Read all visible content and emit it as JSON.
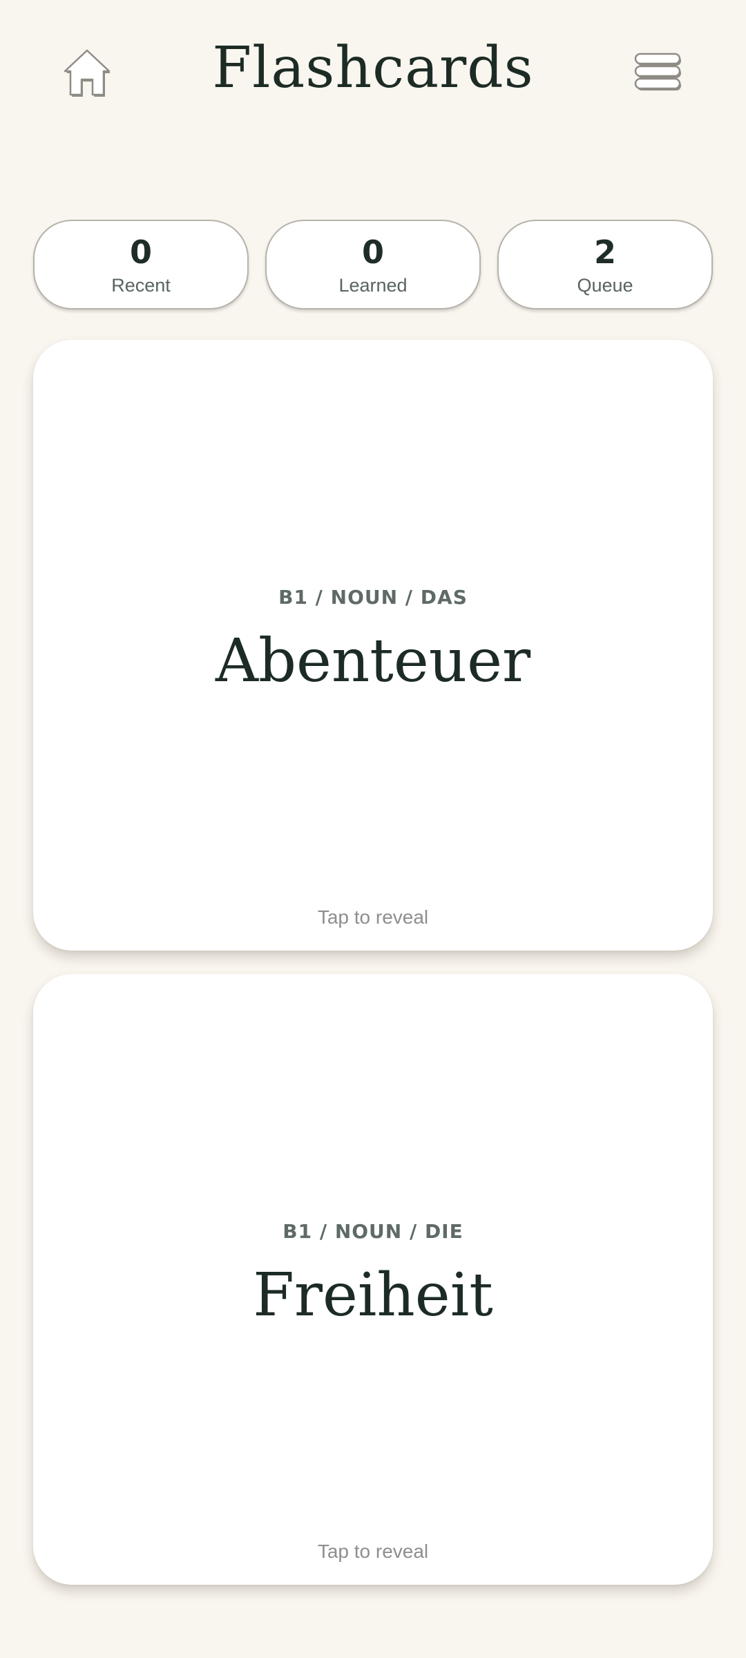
{
  "header": {
    "title": "Flashcards",
    "home_icon": "home-icon",
    "menu_icon": "stacked-menu-icon"
  },
  "stats": [
    {
      "value": "0",
      "label": "Recent"
    },
    {
      "value": "0",
      "label": "Learned"
    },
    {
      "value": "2",
      "label": "Queue"
    }
  ],
  "cards": [
    {
      "meta": "B1 / NOUN / DAS",
      "word": "Abenteuer",
      "hint": "Tap to reveal"
    },
    {
      "meta": "B1 / NOUN / DIE",
      "word": "Freiheit",
      "hint": "Tap to reveal"
    }
  ],
  "colors": {
    "background": "#f9f5ef",
    "text_dark": "#1d2b25",
    "text_muted": "#5f6a66",
    "hint": "#8d8f8c",
    "card": "#ffffff"
  }
}
